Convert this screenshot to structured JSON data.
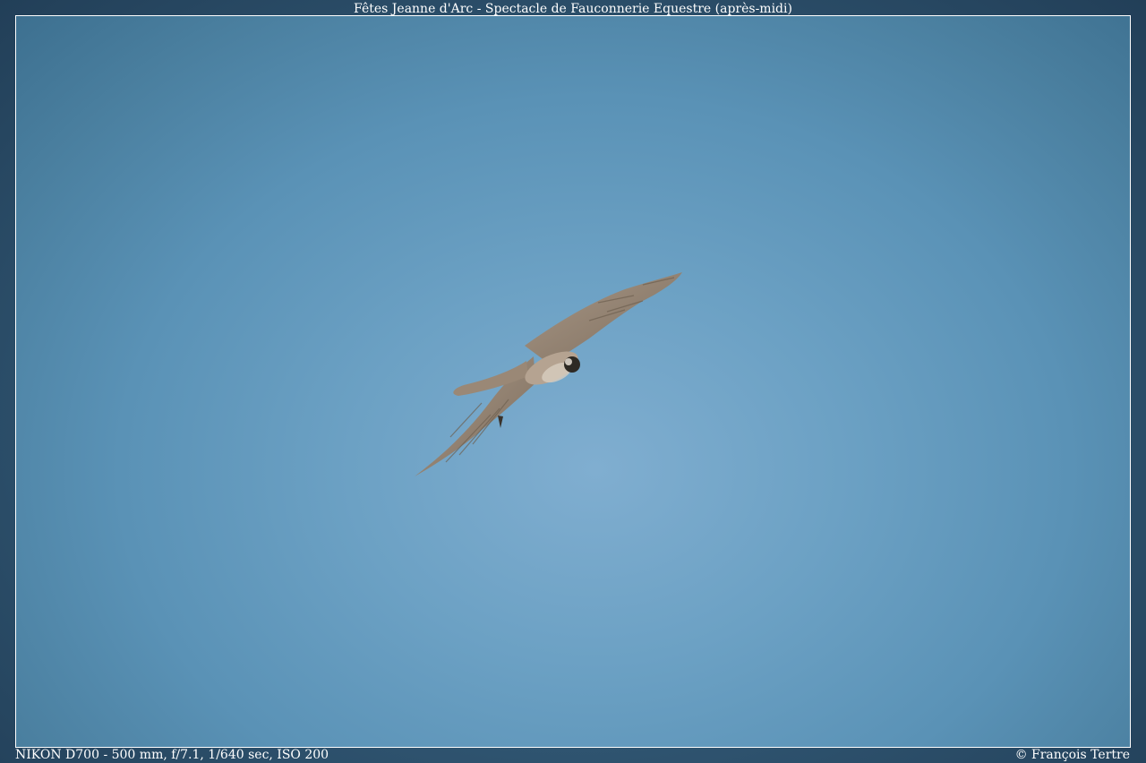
{
  "page": {
    "title": "Fêtes Jeanne d'Arc - Spectacle de Fauconnerie Equestre (après-midi)",
    "exif": "NIKON D700 - 500 mm, f/7.1, 1/640 sec, ISO 200",
    "copyright": "© François Tertre"
  },
  "photo": {
    "subject": "falcon-in-flight",
    "colors": {
      "sky_center": "#80aed0",
      "sky_edge": "#3d7090",
      "bird_wing": "#9a8a78",
      "bird_head": "#2a2620"
    }
  }
}
